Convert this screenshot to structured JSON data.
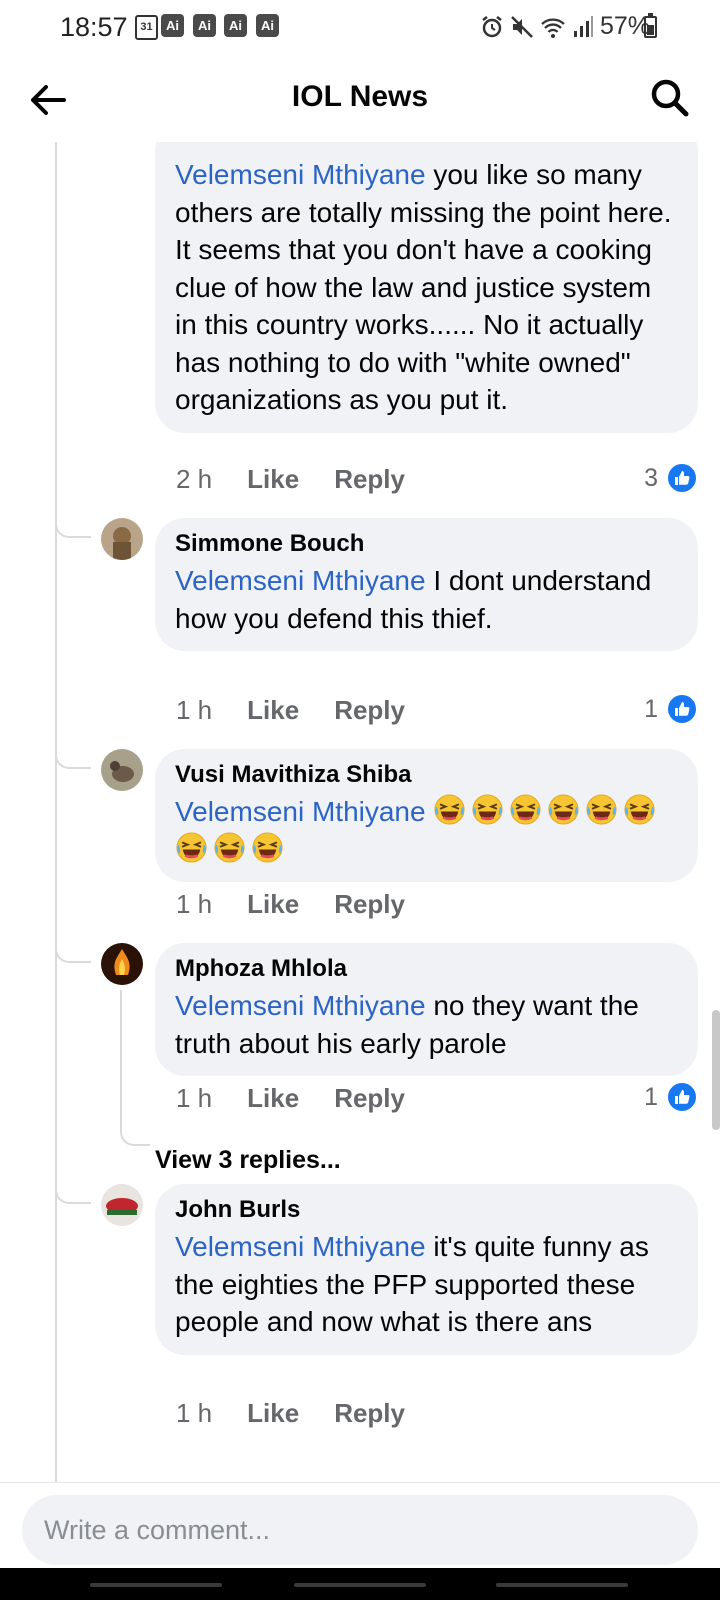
{
  "status": {
    "time": "18:57",
    "calendar_day": "31",
    "badges": [
      "Ai",
      "Ai",
      "Ai",
      "Ai"
    ],
    "battery": "57%",
    "battery_level": 0.57,
    "icons": [
      "alarm-icon",
      "mute-icon",
      "wifi-icon",
      "signal-icon",
      "battery-icon"
    ]
  },
  "header": {
    "title": "IOL News",
    "back_icon": "arrow-left-icon",
    "search_icon": "search-icon"
  },
  "comments": [
    {
      "author": "",
      "mention": "Velemseni Mthiyane",
      "text": " you like so many others are totally missing the point here. It seems that you don't have a cooking clue of how the law and justice system in this country works...... No it actually has nothing to do with \"white owned\" organizations as you put it.",
      "time": "2 h",
      "like_label": "Like",
      "reply_label": "Reply",
      "likes": "3"
    },
    {
      "author": "Simmone Bouch",
      "mention": "Velemseni Mthiyane",
      "text": " I dont understand how you defend this thief.",
      "time": "1 h",
      "like_label": "Like",
      "reply_label": "Reply",
      "likes": "1"
    },
    {
      "author": "Vusi Mavithiza Shiba",
      "mention": "Velemseni Mthiyane",
      "text": "",
      "emoji": "rolling-on-floor-laughing",
      "emoji_count": 9,
      "time": "1 h",
      "like_label": "Like",
      "reply_label": "Reply",
      "likes": ""
    },
    {
      "author": "Mphoza Mhlola",
      "mention": "Velemseni Mthiyane",
      "text": " no they want the truth about his early parole",
      "time": "1 h",
      "like_label": "Like",
      "reply_label": "Reply",
      "likes": "1"
    },
    {
      "author": "John Burls",
      "mention": "Velemseni Mthiyane",
      "text": " it's quite funny as the eighties the PFP supported these  people and now what is there ans",
      "time": "1 h",
      "like_label": "Like",
      "reply_label": "Reply",
      "likes": ""
    }
  ],
  "view_replies": "View 3 replies...",
  "composer": {
    "placeholder": "Write a comment..."
  },
  "colors": {
    "mention": "#2c64c6",
    "bubble": "#f0f2f5",
    "like_badge": "#1877f2",
    "meta": "#65676b"
  }
}
